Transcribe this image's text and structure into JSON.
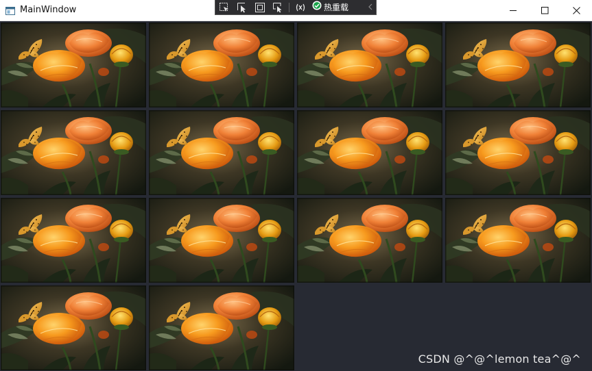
{
  "window": {
    "title": "MainWindow",
    "app_icon": "wpf-window-icon",
    "controls": [
      "minimize-icon",
      "maximize-icon",
      "close-icon"
    ]
  },
  "debug_toolbar": {
    "buttons": [
      "select-element-icon",
      "select-in-tree-icon",
      "display-layout-adorners-icon",
      "track-focused-element-icon",
      "binding-failures-icon"
    ],
    "hot_reload_label": "热重载",
    "hot_reload_status": "check-circle-icon",
    "collapse_icon": "chevron-left-icon"
  },
  "gallery": {
    "tile_count": 14,
    "image_subject": "orange flowers with butterfly",
    "background_color": "#272a33"
  },
  "watermark": {
    "text": "CSDN @^@^lemon tea^@^"
  }
}
